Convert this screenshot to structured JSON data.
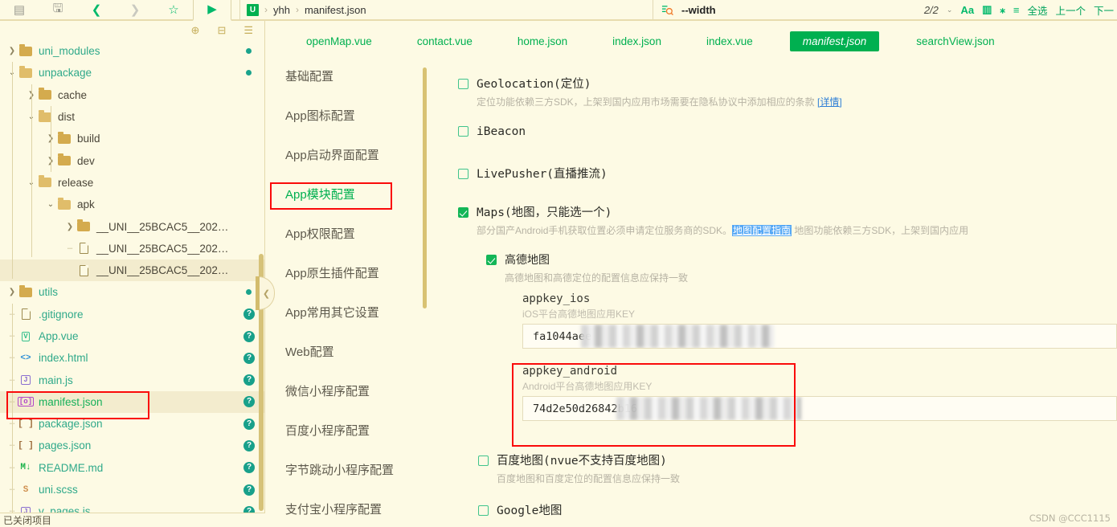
{
  "toolbar": {
    "buttons": [
      {
        "name": "terminal-icon",
        "glyph": "▤"
      },
      {
        "name": "save-icon",
        "glyph": "🖫"
      },
      {
        "name": "back-icon",
        "glyph": "❮"
      },
      {
        "name": "forward-icon",
        "glyph": "❯"
      },
      {
        "name": "favorite-star-icon",
        "glyph": "☆"
      },
      {
        "name": "run-icon",
        "glyph": "▶"
      }
    ],
    "breadcrumb": {
      "badge": "U",
      "project": "yhh",
      "file": "manifest.json",
      "separator": "›"
    },
    "search": {
      "icon": "search-with-options-icon",
      "query": "--width",
      "match_count": "2/2",
      "chevron": "⌄",
      "options": [
        {
          "name": "match-case-icon",
          "glyph": "Aa"
        },
        {
          "name": "whole-word-icon",
          "glyph": "▥"
        },
        {
          "name": "regex-icon",
          "glyph": "⁎"
        },
        {
          "name": "in-selection-icon",
          "glyph": "≡"
        }
      ],
      "select_all_label": "全选",
      "prev_label": "上一个",
      "next_label": "下一"
    }
  },
  "filetree": {
    "header_icons": [
      {
        "name": "locate-file-icon",
        "glyph": "⊕"
      },
      {
        "name": "collapse-all-icon",
        "glyph": "⊟"
      },
      {
        "name": "tree-menu-icon",
        "glyph": "☰"
      }
    ],
    "status_bar": "已关闭项目",
    "rows": [
      {
        "label": "uni_modules",
        "indent": 0,
        "arrow": "right",
        "icon": "folder",
        "color": "teal",
        "marker": "dot"
      },
      {
        "label": "unpackage",
        "indent": 0,
        "arrow": "down",
        "icon": "folder-open",
        "color": "teal",
        "marker": "dot"
      },
      {
        "label": "cache",
        "indent": 1,
        "arrow": "right",
        "icon": "folder",
        "color": "plain",
        "marker": ""
      },
      {
        "label": "dist",
        "indent": 1,
        "arrow": "down",
        "icon": "folder-open",
        "color": "plain",
        "marker": ""
      },
      {
        "label": "build",
        "indent": 2,
        "arrow": "right",
        "icon": "folder",
        "color": "plain",
        "marker": ""
      },
      {
        "label": "dev",
        "indent": 2,
        "arrow": "right",
        "icon": "folder",
        "color": "plain",
        "marker": ""
      },
      {
        "label": "release",
        "indent": 1,
        "arrow": "down",
        "icon": "folder-open",
        "color": "plain",
        "marker": ""
      },
      {
        "label": "apk",
        "indent": 2,
        "arrow": "down",
        "icon": "folder-open",
        "color": "plain",
        "marker": ""
      },
      {
        "label": "__UNI__25BCAC5__202…",
        "indent": 3,
        "arrow": "right",
        "icon": "folder",
        "color": "plain",
        "marker": ""
      },
      {
        "label": "__UNI__25BCAC5__202…",
        "indent": 3,
        "arrow": "dash",
        "icon": "file",
        "color": "plain",
        "marker": ""
      },
      {
        "label": "__UNI__25BCAC5__202…",
        "indent": 3,
        "arrow": "none",
        "icon": "file",
        "color": "plain",
        "marker": "",
        "selected": true
      },
      {
        "label": "utils",
        "indent": 0,
        "arrow": "right",
        "icon": "folder",
        "color": "teal",
        "marker": "dot"
      },
      {
        "label": ".gitignore",
        "indent": 0,
        "arrow": "dash",
        "icon": "file",
        "color": "teal",
        "marker": "q"
      },
      {
        "label": "App.vue",
        "indent": 0,
        "arrow": "dash",
        "icon": "vue",
        "color": "teal",
        "marker": "q"
      },
      {
        "label": "index.html",
        "indent": 0,
        "arrow": "dash",
        "icon": "html",
        "color": "teal",
        "marker": "q"
      },
      {
        "label": "main.js",
        "indent": 0,
        "arrow": "dash",
        "icon": "js",
        "color": "teal",
        "marker": "q"
      },
      {
        "label": "manifest.json",
        "indent": 0,
        "arrow": "dash",
        "icon": "manifest",
        "color": "green",
        "marker": "q",
        "selected": true,
        "highlighted": true
      },
      {
        "label": "package.json",
        "indent": 0,
        "arrow": "dash",
        "icon": "pkg",
        "color": "teal",
        "marker": "q"
      },
      {
        "label": "pages.json",
        "indent": 0,
        "arrow": "dash",
        "icon": "pkg",
        "color": "teal",
        "marker": "q"
      },
      {
        "label": "README.md",
        "indent": 0,
        "arrow": "dash",
        "icon": "md",
        "color": "teal",
        "marker": "q"
      },
      {
        "label": "uni.scss",
        "indent": 0,
        "arrow": "dash",
        "icon": "scss",
        "color": "teal",
        "marker": "q"
      },
      {
        "label": "v_pages.js",
        "indent": 0,
        "arrow": "dash",
        "icon": "js",
        "color": "teal",
        "marker": "q"
      }
    ]
  },
  "editor_tabs": [
    {
      "label": "openMap.vue",
      "active": false
    },
    {
      "label": "contact.vue",
      "active": false
    },
    {
      "label": "home.json",
      "active": false
    },
    {
      "label": "index.json",
      "active": false
    },
    {
      "label": "index.vue",
      "active": false
    },
    {
      "label": "manifest.json",
      "active": true
    },
    {
      "label": "searchView.json",
      "active": false
    }
  ],
  "midnav": {
    "items": [
      {
        "label": "基础配置",
        "active": false
      },
      {
        "label": "App图标配置",
        "active": false
      },
      {
        "label": "App启动界面配置",
        "active": false
      },
      {
        "label": "App模块配置",
        "active": true
      },
      {
        "label": "App权限配置",
        "active": false
      },
      {
        "label": "App原生插件配置",
        "active": false
      },
      {
        "label": "App常用其它设置",
        "active": false
      },
      {
        "label": "Web配置",
        "active": false
      },
      {
        "label": "微信小程序配置",
        "active": false
      },
      {
        "label": "百度小程序配置",
        "active": false
      },
      {
        "label": "字节跳动小程序配置",
        "active": false
      },
      {
        "label": "支付宝小程序配置",
        "active": false
      }
    ]
  },
  "content": {
    "geolocation": {
      "title": "Geolocation(定位)",
      "checked": false,
      "desc": "定位功能依赖三方SDK，上架到国内应用市场需要在隐私协议中添加相应的条款",
      "link": "[详情]"
    },
    "ibeacon": {
      "title": "iBeacon",
      "checked": false
    },
    "livepusher": {
      "title": "LivePusher(直播推流)",
      "checked": false
    },
    "maps": {
      "title": "Maps(地图，只能选一个)",
      "checked": true,
      "desc_before": "部分国产Android手机获取位置必须申请定位服务商的SDK。",
      "desc_link": "地图配置指南",
      "desc_after": "地图功能依赖三方SDK，上架到国内应用"
    },
    "amap": {
      "title": "高德地图",
      "checked": true,
      "desc": "高德地图和高德定位的配置信息应保持一致",
      "appkey_ios": {
        "label": "appkey_ios",
        "sub": "iOS平台高德地图应用KEY",
        "value": "fa1044aee"
      },
      "appkey_android": {
        "label": "appkey_android",
        "sub": "Android平台高德地图应用KEY",
        "value": "74d2e50d26842b16"
      }
    },
    "baidu": {
      "title": "百度地图(nvue不支持百度地图)",
      "checked": false,
      "desc": "百度地图和百度定位的配置信息应保持一致"
    },
    "google": {
      "title": "Google地图",
      "checked": false
    }
  },
  "watermark": "CSDN @CCC1115",
  "colors": {
    "accent_green": "#00b050",
    "page_bg": "#fdfae4",
    "folder": "#d4ab4e",
    "highlight_red": "#fa0a0a",
    "teal_text": "#2fa98a"
  }
}
